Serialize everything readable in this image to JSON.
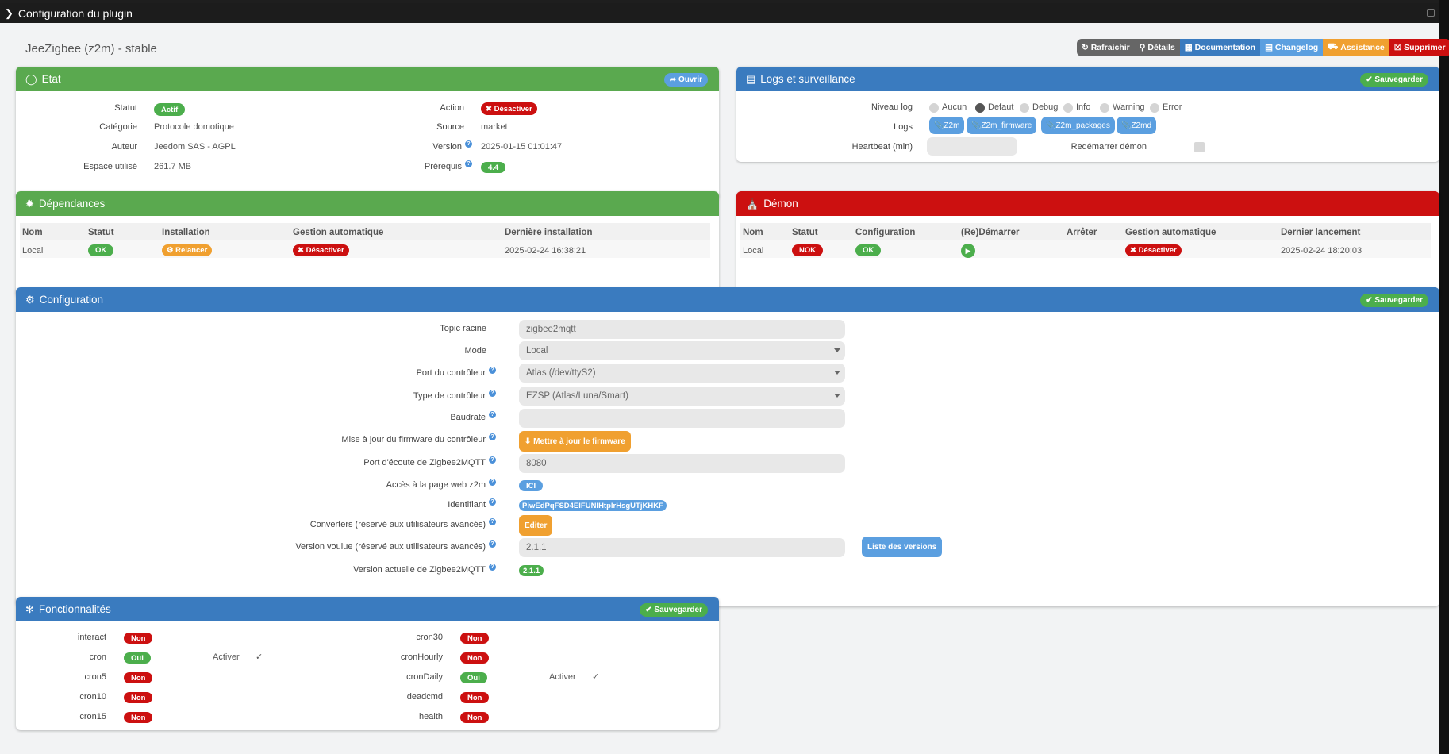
{
  "window": {
    "title": "Configuration du plugin"
  },
  "plugin": {
    "title": "JeeZigbee (z2m) - stable"
  },
  "toolbar": [
    {
      "label": "Rafraichir",
      "icon": "refresh-icon",
      "color": "#666666"
    },
    {
      "label": "Détails",
      "icon": "search-icon",
      "color": "#666666"
    },
    {
      "label": "Documentation",
      "icon": "book-icon",
      "color": "#3a7bbf"
    },
    {
      "label": "Changelog",
      "icon": "file-icon",
      "color": "#5b9fe0"
    },
    {
      "label": "Assistance",
      "icon": "ambulance-icon",
      "color": "#f0a030"
    },
    {
      "label": "Supprimer",
      "icon": "trash-icon",
      "color": "#cc1010"
    }
  ],
  "etat": {
    "title": "Etat",
    "open_label": "Ouvrir",
    "statut_label": "Statut",
    "statut": "Actif",
    "categorie_label": "Catégorie",
    "categorie": "Protocole domotique",
    "auteur_label": "Auteur",
    "auteur": "Jeedom SAS - AGPL",
    "espace_label": "Espace utilisé",
    "espace": "261.7 MB",
    "action_label": "Action",
    "action": "Désactiver",
    "source_label": "Source",
    "source": "market",
    "version_label": "Version",
    "version": "2025-01-15 01:01:47",
    "prerequis_label": "Prérequis",
    "prerequis": "4.4"
  },
  "logs": {
    "title": "Logs et surveillance",
    "save_label": "Sauvegarder",
    "niveau_label": "Niveau log",
    "levels": [
      "Aucun",
      "Defaut",
      "Debug",
      "Info",
      "Warning",
      "Error"
    ],
    "selected_level": "Defaut",
    "logs_label": "Logs",
    "log_buttons": [
      "Z2m",
      "Z2m_firmware",
      "Z2m_packages",
      "Z2md"
    ],
    "heartbeat_label": "Heartbeat (min)",
    "heartbeat_value": "",
    "restart_label": "Redémarrer démon",
    "restart_checked": false
  },
  "dependances": {
    "title": "Dépendances",
    "headers": [
      "Nom",
      "Statut",
      "Installation",
      "Gestion automatique",
      "Dernière installation"
    ],
    "row": {
      "nom": "Local",
      "statut": "OK",
      "installation": "Relancer",
      "gestion": "Désactiver",
      "derniere": "2025-02-24 16:38:21"
    }
  },
  "demon": {
    "title": "Démon",
    "headers": [
      "Nom",
      "Statut",
      "Configuration",
      "(Re)Démarrer",
      "Arrêter",
      "Gestion automatique",
      "Dernier lancement"
    ],
    "row": {
      "nom": "Local",
      "statut": "NOK",
      "configuration": "OK",
      "gestion": "Désactiver",
      "dernier": "2025-02-24 18:20:03"
    }
  },
  "config": {
    "title": "Configuration",
    "save_label": "Sauvegarder",
    "topic_label": "Topic racine",
    "topic": "zigbee2mqtt",
    "mode_label": "Mode",
    "mode": "Local",
    "port_label": "Port du contrôleur",
    "port": "Atlas (/dev/ttyS2)",
    "type_label": "Type de contrôleur",
    "type": "EZSP (Atlas/Luna/Smart)",
    "baudrate_label": "Baudrate",
    "baudrate": "",
    "firmware_label": "Mise à jour du firmware du contrôleur",
    "firmware_btn": "Mettre à jour le firmware",
    "listen_label": "Port d'écoute de Zigbee2MQTT",
    "listen": "8080",
    "web_label": "Accès à la page web z2m",
    "web_btn": "ICI",
    "id_label": "Identifiant",
    "id": "PiwEdPqFSD4ElFUNIHtplrHsgUTjKHKF",
    "conv_label": "Converters (réservé aux utilisateurs avancés)",
    "conv_btn": "Editer",
    "vwant_label": "Version voulue (réservé aux utilisateurs avancés)",
    "vwant": "2.1.1",
    "versions_btn": "Liste des versions",
    "vcur_label": "Version actuelle de Zigbee2MQTT",
    "vcur": "2.1.1"
  },
  "fonct": {
    "title": "Fonctionnalités",
    "save_label": "Sauvegarder",
    "activer_label": "Activer",
    "left": [
      {
        "name": "interact",
        "value": "Non"
      },
      {
        "name": "cron",
        "value": "Oui"
      },
      {
        "name": "cron5",
        "value": "Non"
      },
      {
        "name": "cron10",
        "value": "Non"
      },
      {
        "name": "cron15",
        "value": "Non"
      }
    ],
    "right": [
      {
        "name": "cron30",
        "value": "Non"
      },
      {
        "name": "cronHourly",
        "value": "Non"
      },
      {
        "name": "cronDaily",
        "value": "Oui"
      },
      {
        "name": "deadcmd",
        "value": "Non"
      },
      {
        "name": "health",
        "value": "Non"
      }
    ]
  }
}
